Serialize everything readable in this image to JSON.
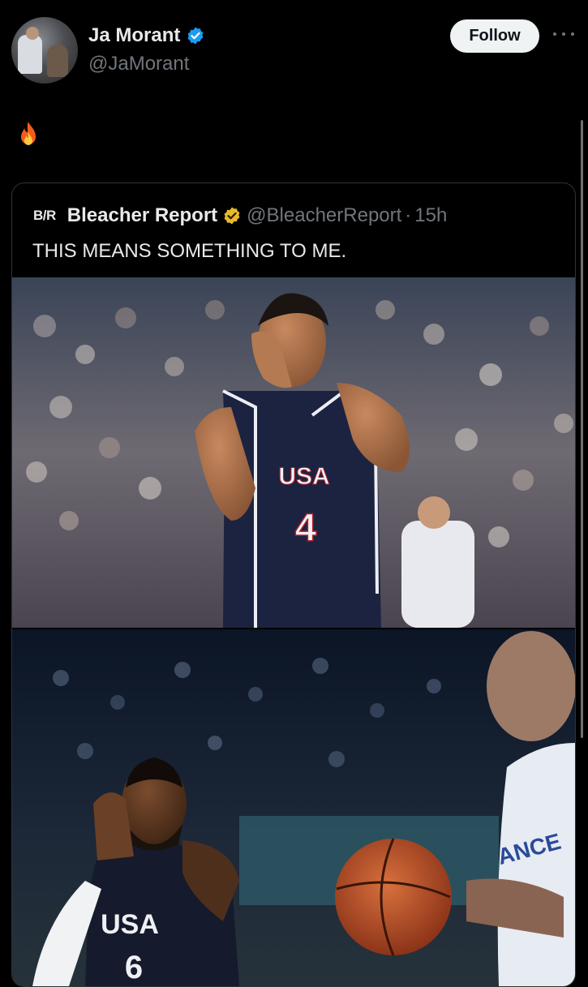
{
  "author": {
    "display_name": "Ja Morant",
    "handle": "@JaMorant",
    "verified": true,
    "verified_badge_color": "#1d9bf0",
    "avatar_icon": "profile-photo"
  },
  "follow_label": "Follow",
  "more_icon": "ellipsis-icon",
  "tweet_text_icon": "fire-emoji",
  "quoted_tweet": {
    "logo": "B/R",
    "display_name": "Bleacher Report",
    "verified_badge": "gold",
    "verified_badge_color": "#e8b92c",
    "handle": "@BleacherReport",
    "separator": "·",
    "time": "15h",
    "text": "THIS MEANS SOMETHING TO ME.",
    "photo1": {
      "description_icon": "player-hands-to-face-photo",
      "jersey_team": "USA",
      "jersey_number": "4",
      "jersey_color": "#1c2340"
    },
    "photo2": {
      "description_icon": "player-praying-hands-photo",
      "jersey_team": "USA",
      "jersey_number": "6",
      "opponent_jersey": "ANCE",
      "ball_color": "#c8552a"
    }
  }
}
